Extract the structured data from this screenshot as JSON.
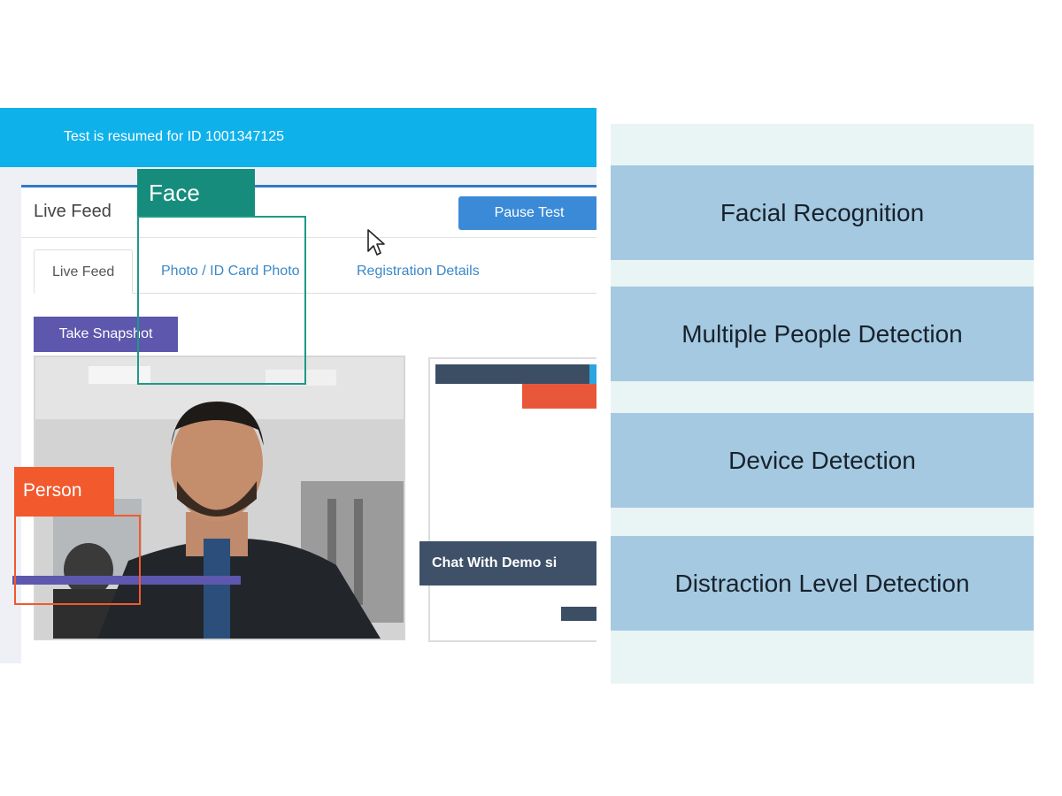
{
  "banner": {
    "message": "Test is resumed for ID 1001347125"
  },
  "panel": {
    "title": "Live Feed",
    "pause_label": "Pause Test",
    "tabs": [
      {
        "label": "Live Feed",
        "active": true
      },
      {
        "label": "Photo / ID Card Photo",
        "active": false
      },
      {
        "label": "Registration Details",
        "active": false
      }
    ],
    "snapshot_label": "Take Snapshot",
    "chat_label": "Chat With Demo si"
  },
  "detections": {
    "face_label": "Face",
    "person_label": "Person"
  },
  "features": [
    {
      "label": "Facial Recognition"
    },
    {
      "label": "Multiple People Detection"
    },
    {
      "label": "Device Detection"
    },
    {
      "label": "Distraction Level Detection"
    }
  ],
  "colors": {
    "banner": "#0fb1ea",
    "pause_button": "#3b8ad8",
    "snapshot_button": "#5d57ad",
    "face_box": "#168d7c",
    "person_box": "#f2592d",
    "feature_box": "#a5c9e1"
  },
  "icons": {
    "pointer": "mouse-pointer-icon"
  }
}
